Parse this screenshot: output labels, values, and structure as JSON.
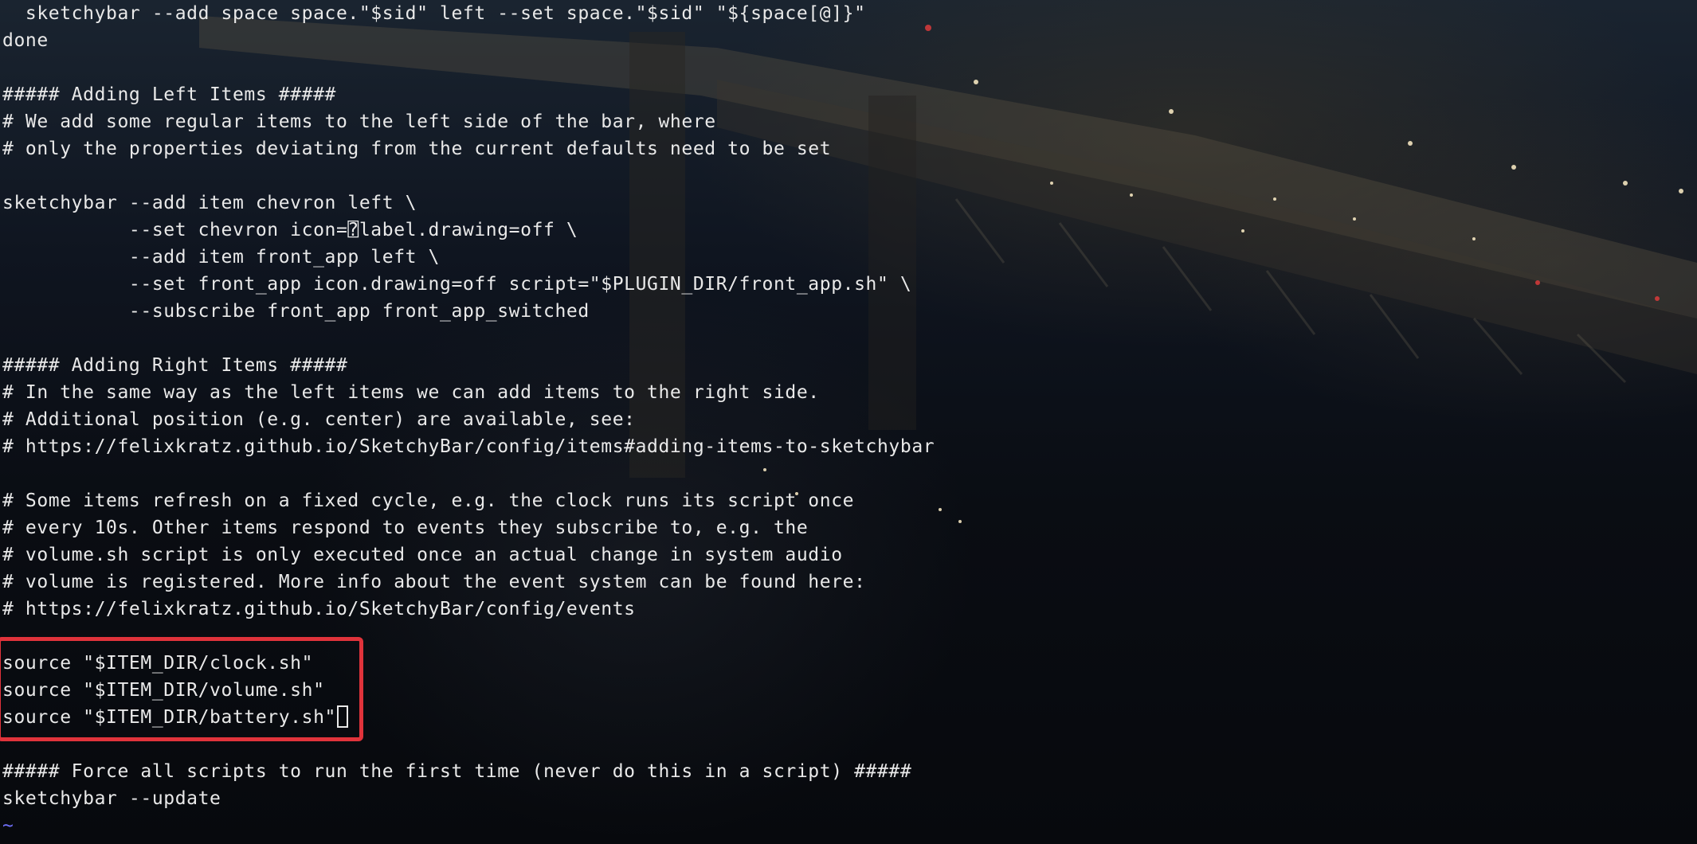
{
  "editor": {
    "lines": [
      "  sketchybar --add space space.\"$sid\" left --set space.\"$sid\" \"${space[@]}\"",
      "done",
      "",
      "##### Adding Left Items #####",
      "# We add some regular items to the left side of the bar, where",
      "# only the properties deviating from the current defaults need to be set",
      "",
      "sketchybar --add item chevron left \\",
      "           --set chevron icon=⍰label.drawing=off \\",
      "           --add item front_app left \\",
      "           --set front_app icon.drawing=off script=\"$PLUGIN_DIR/front_app.sh\" \\",
      "           --subscribe front_app front_app_switched",
      "",
      "##### Adding Right Items #####",
      "# In the same way as the left items we can add items to the right side.",
      "# Additional position (e.g. center) are available, see:",
      "# https://felixkratz.github.io/SketchyBar/config/items#adding-items-to-sketchybar",
      "",
      "# Some items refresh on a fixed cycle, e.g. the clock runs its script once",
      "# every 10s. Other items respond to events they subscribe to, e.g. the",
      "# volume.sh script is only executed once an actual change in system audio",
      "# volume is registered. More info about the event system can be found here:",
      "# https://felixkratz.github.io/SketchyBar/config/events",
      "",
      "source \"$ITEM_DIR/clock.sh\"",
      "source \"$ITEM_DIR/volume.sh\"",
      "source \"$ITEM_DIR/battery.sh\"",
      "",
      "##### Force all scripts to run the first time (never do this in a script) #####",
      "sketchybar --update",
      "~"
    ],
    "cursor_line_index": 26
  },
  "colors": {
    "text": "#e9e9e9",
    "tilde": "#6e6ef7",
    "highlight_border": "#e0333b"
  }
}
